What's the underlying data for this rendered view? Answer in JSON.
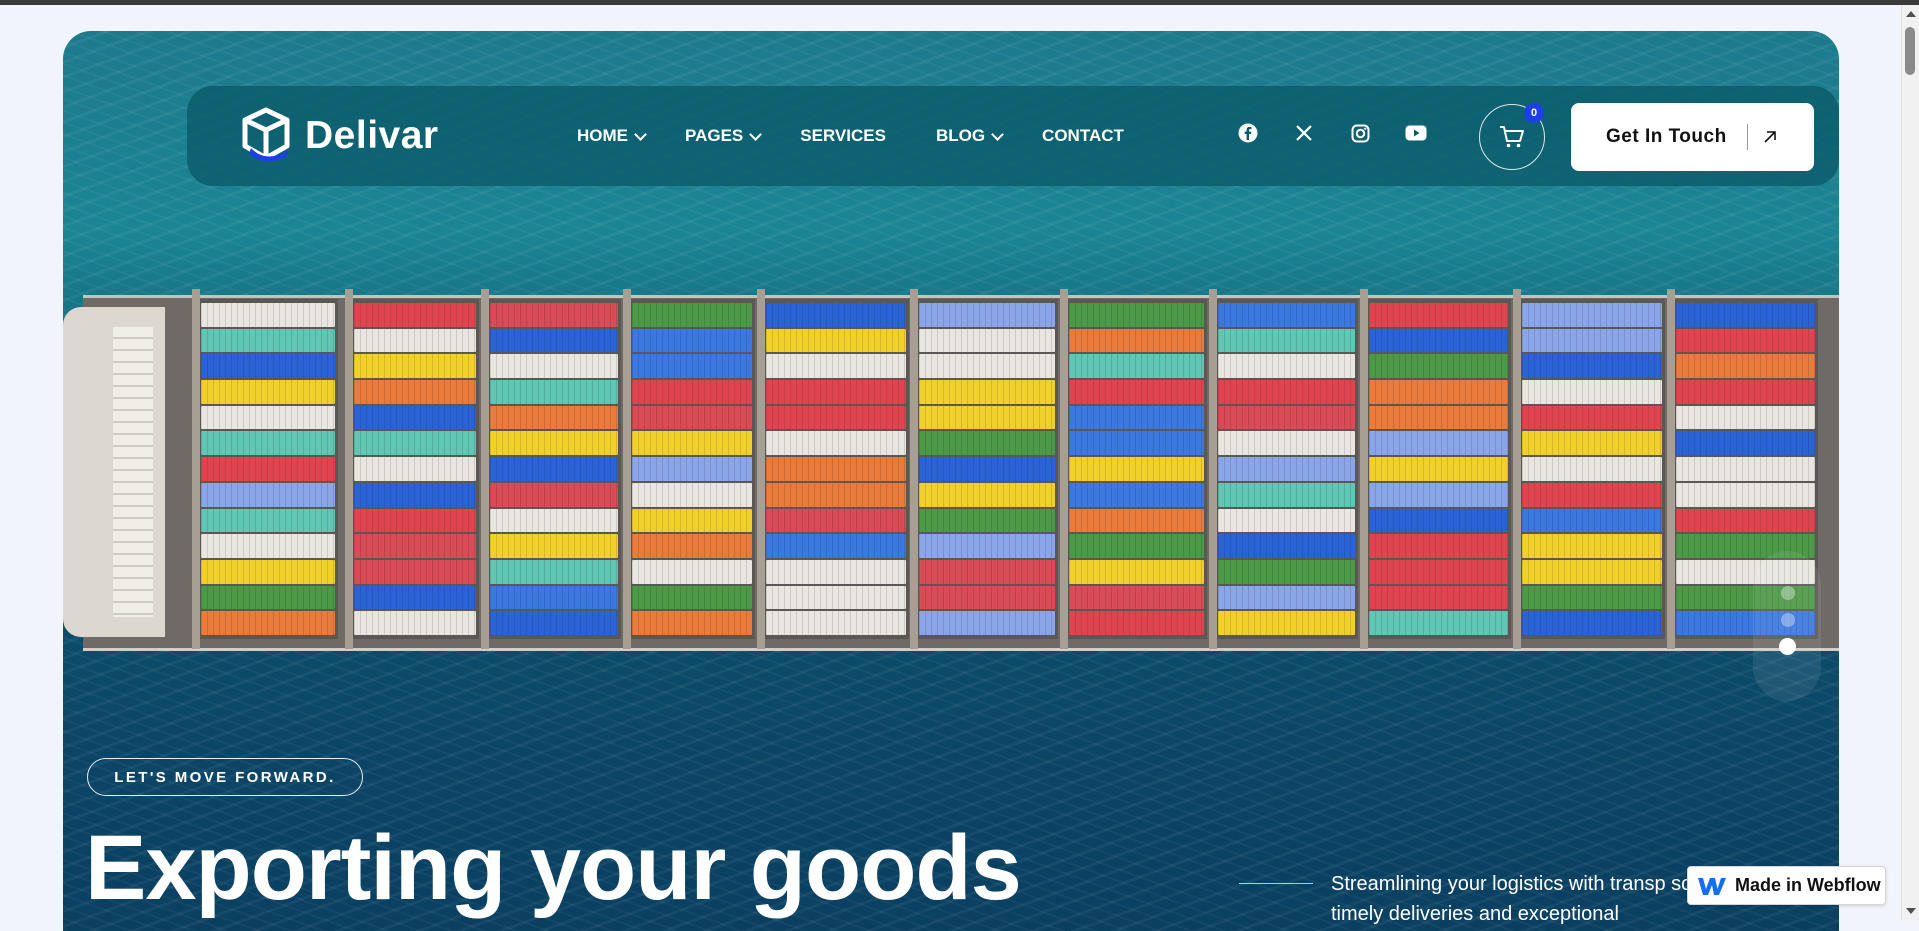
{
  "brand": {
    "name": "Delivar"
  },
  "nav": {
    "items": [
      {
        "label": "HOME",
        "dropdown": true
      },
      {
        "label": "PAGES",
        "dropdown": true
      },
      {
        "label": "SERVICES",
        "dropdown": false
      },
      {
        "label": "BLOG",
        "dropdown": true
      },
      {
        "label": "CONTACT",
        "dropdown": false
      }
    ],
    "socials": [
      "facebook-icon",
      "x-icon",
      "instagram-icon",
      "youtube-icon"
    ],
    "cart_count": "0",
    "cta_label": "Get In Touch"
  },
  "hero": {
    "badge": "LET'S MOVE FORWARD.",
    "headline": "Exporting your goods",
    "subtext": "Streamlining your logistics with transp solutions timely deliveries and exceptional",
    "slides": {
      "count": 3,
      "active": 3
    }
  },
  "webflow_badge": {
    "label": "Made in Webflow"
  },
  "colors": {
    "accent": "#1d3fe6",
    "nav_bg": "#0b5a69",
    "sea": "#167688"
  }
}
